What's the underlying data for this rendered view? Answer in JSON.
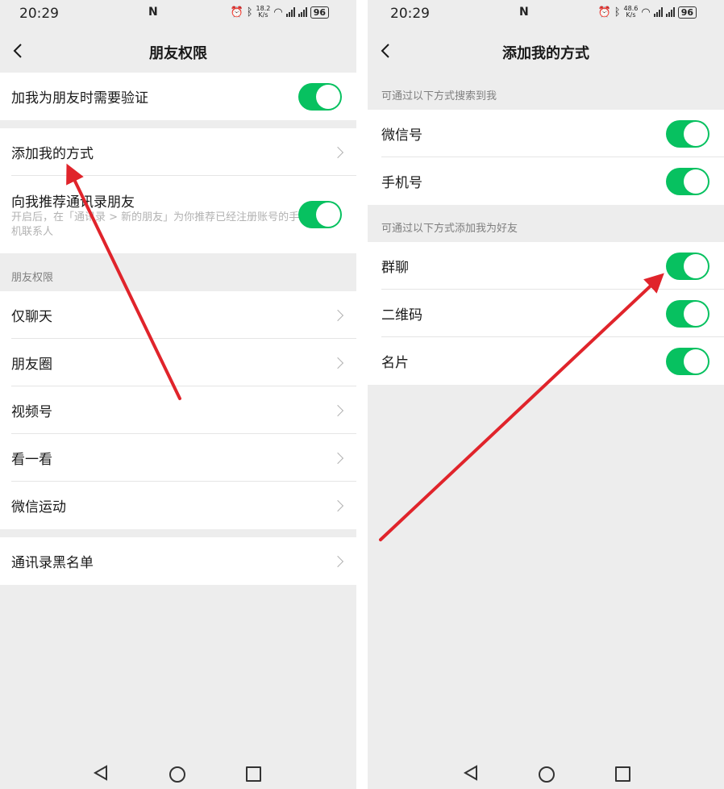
{
  "status_left": {
    "time": "20:29",
    "net_speed_top": "18.2",
    "net_speed_bottom": "K/s",
    "battery": "96"
  },
  "status_right": {
    "time": "20:29",
    "net_speed_top": "48.6",
    "net_speed_bottom": "K/s",
    "battery": "96"
  },
  "left": {
    "title": "朋友权限",
    "verify_label": "加我为朋友时需要验证",
    "verify_on": true,
    "add_method_label": "添加我的方式",
    "recommend_label": "向我推荐通讯录朋友",
    "recommend_desc": "开启后，在「通讯录 > 新的朋友」为你推荐已经注册账号的手机联系人",
    "recommend_on": true,
    "section_label": "朋友权限",
    "permission_items": [
      "仅聊天",
      "朋友圈",
      "视频号",
      "看一看",
      "微信运动"
    ],
    "blacklist_label": "通讯录黑名单"
  },
  "right": {
    "title": "添加我的方式",
    "search_section_label": "可通过以下方式搜索到我",
    "search_items": [
      {
        "label": "微信号",
        "on": true
      },
      {
        "label": "手机号",
        "on": true
      }
    ],
    "add_section_label": "可通过以下方式添加我为好友",
    "add_items": [
      {
        "label": "群聊",
        "on": true
      },
      {
        "label": "二维码",
        "on": true
      },
      {
        "label": "名片",
        "on": true
      }
    ]
  },
  "colors": {
    "toggle_on": "#07c160",
    "annotation_arrow": "#e0242b",
    "background": "#ededed"
  }
}
